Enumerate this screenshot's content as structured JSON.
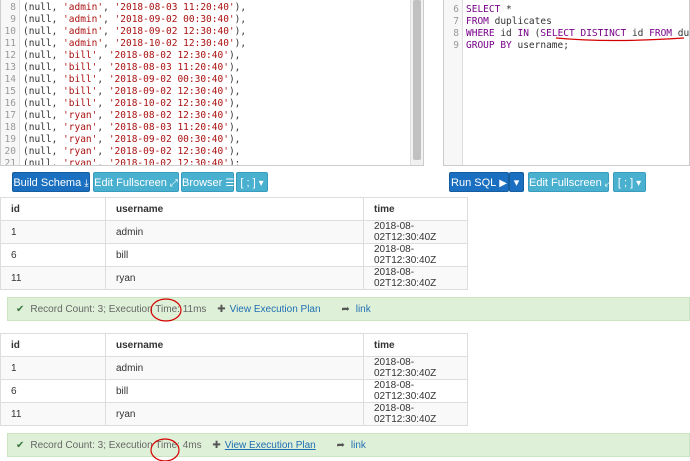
{
  "schema_editor": {
    "lines": [
      {
        "n": "8",
        "user": "'admin'",
        "time": "'2018-08-03 11:20:40'"
      },
      {
        "n": "9",
        "user": "'admin'",
        "time": "'2018-09-02 00:30:40'"
      },
      {
        "n": "10",
        "user": "'admin'",
        "time": "'2018-09-02 12:30:40'"
      },
      {
        "n": "11",
        "user": "'admin'",
        "time": "'2018-10-02 12:30:40'"
      },
      {
        "n": "12",
        "user": "'bill'",
        "time": "'2018-08-02 12:30:40'"
      },
      {
        "n": "13",
        "user": "'bill'",
        "time": "'2018-08-03 11:20:40'"
      },
      {
        "n": "14",
        "user": "'bill'",
        "time": "'2018-09-02 00:30:40'"
      },
      {
        "n": "15",
        "user": "'bill'",
        "time": "'2018-09-02 12:30:40'"
      },
      {
        "n": "16",
        "user": "'bill'",
        "time": "'2018-10-02 12:30:40'"
      },
      {
        "n": "17",
        "user": "'ryan'",
        "time": "'2018-08-02 12:30:40'"
      },
      {
        "n": "18",
        "user": "'ryan'",
        "time": "'2018-08-03 11:20:40'"
      },
      {
        "n": "19",
        "user": "'ryan'",
        "time": "'2018-09-02 00:30:40'"
      },
      {
        "n": "20",
        "user": "'ryan'",
        "time": "'2018-09-02 12:30:40'"
      },
      {
        "n": "21",
        "user": "'ryan'",
        "time": "'2018-10-02 12:30:40'"
      }
    ],
    "row_prefix": "(null, ",
    "sep": ", ",
    "row_suffix": "),",
    "last_suffix": ");"
  },
  "query_editor": {
    "lines": [
      {
        "n": "6",
        "text": "SELECT *"
      },
      {
        "n": "7",
        "text": "FROM duplicates"
      },
      {
        "n": "8",
        "text": "WHERE id IN (SELECT DISTINCT id FROM duplicates)"
      },
      {
        "n": "9",
        "text": "GROUP BY username;"
      }
    ]
  },
  "toolbar": {
    "build_schema": "Build Schema",
    "edit_fullscreen": "Edit Fullscreen",
    "browser": "Browser",
    "delimiter": "[ ; ]",
    "run_sql": "Run SQL",
    "edit_fullscreen_right": "Edit Fullscreen",
    "delimiter_right": "[ ; ]"
  },
  "results": [
    {
      "headers": [
        "id",
        "username",
        "time"
      ],
      "rows": [
        [
          "1",
          "admin",
          "2018-08-02T12:30:40Z"
        ],
        [
          "6",
          "bill",
          "2018-08-02T12:30:40Z"
        ],
        [
          "11",
          "ryan",
          "2018-08-02T12:30:40Z"
        ]
      ],
      "status": {
        "text": "Record Count: 3; Execution Time: ",
        "ms": "11ms",
        "plan": "View Execution Plan",
        "link": "link"
      }
    },
    {
      "headers": [
        "id",
        "username",
        "time"
      ],
      "rows": [
        [
          "1",
          "admin",
          "2018-08-02T12:30:40Z"
        ],
        [
          "6",
          "bill",
          "2018-08-02T12:30:40Z"
        ],
        [
          "11",
          "ryan",
          "2018-08-02T12:30:40Z"
        ]
      ],
      "status": {
        "text": "Record Count: 3; Execution Time: ",
        "ms": "4ms",
        "plan": "View Execution Plan",
        "link": "link"
      }
    }
  ],
  "colors": {
    "primary": "#1a6fc0",
    "info": "#4ab0d0",
    "success_bg": "#dff0d8",
    "annotation": "#d40000"
  }
}
